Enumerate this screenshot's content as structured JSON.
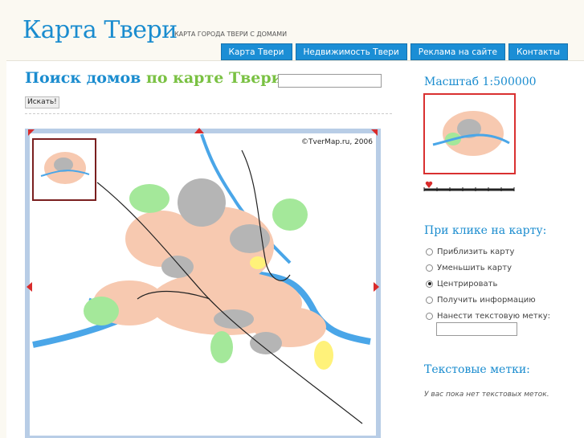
{
  "header": {
    "title": "Карта Твери",
    "tagline": "КАРТА ГОРОДА ТВЕРИ С ДОМАМИ"
  },
  "nav": [
    {
      "label": "Карта Твери"
    },
    {
      "label": "Недвижимость Твери"
    },
    {
      "label": "Реклама на сайте"
    },
    {
      "label": "Контакты"
    }
  ],
  "search": {
    "heading_part1": "Поиск домов",
    "heading_part2": "по карте Твери",
    "heading_part3": ":",
    "input_value": "",
    "button_label": "Искать!"
  },
  "map": {
    "copyright": "©TverMap.ru, 2006",
    "colors": {
      "water": "#4aa6e8",
      "green": "#a4e89a",
      "residential": "#f7c9b0",
      "industrial": "#b5b5b5",
      "frame": "#b8cde6",
      "arrow": "#d92b2b"
    }
  },
  "sidebar": {
    "scale_heading": "Масштаб 1:500000",
    "click_heading": "При клике на карту:",
    "options": [
      {
        "label": "Приблизить карту",
        "checked": false
      },
      {
        "label": "Уменьшить карту",
        "checked": false
      },
      {
        "label": "Центрировать",
        "checked": true
      },
      {
        "label": "Получить информацию",
        "checked": false
      },
      {
        "label": "Нанести текстовую метку:",
        "checked": false
      }
    ],
    "mark_input_value": "",
    "marks_heading": "Текстовые метки:",
    "marks_empty": "У вас пока нет текстовых меток."
  }
}
